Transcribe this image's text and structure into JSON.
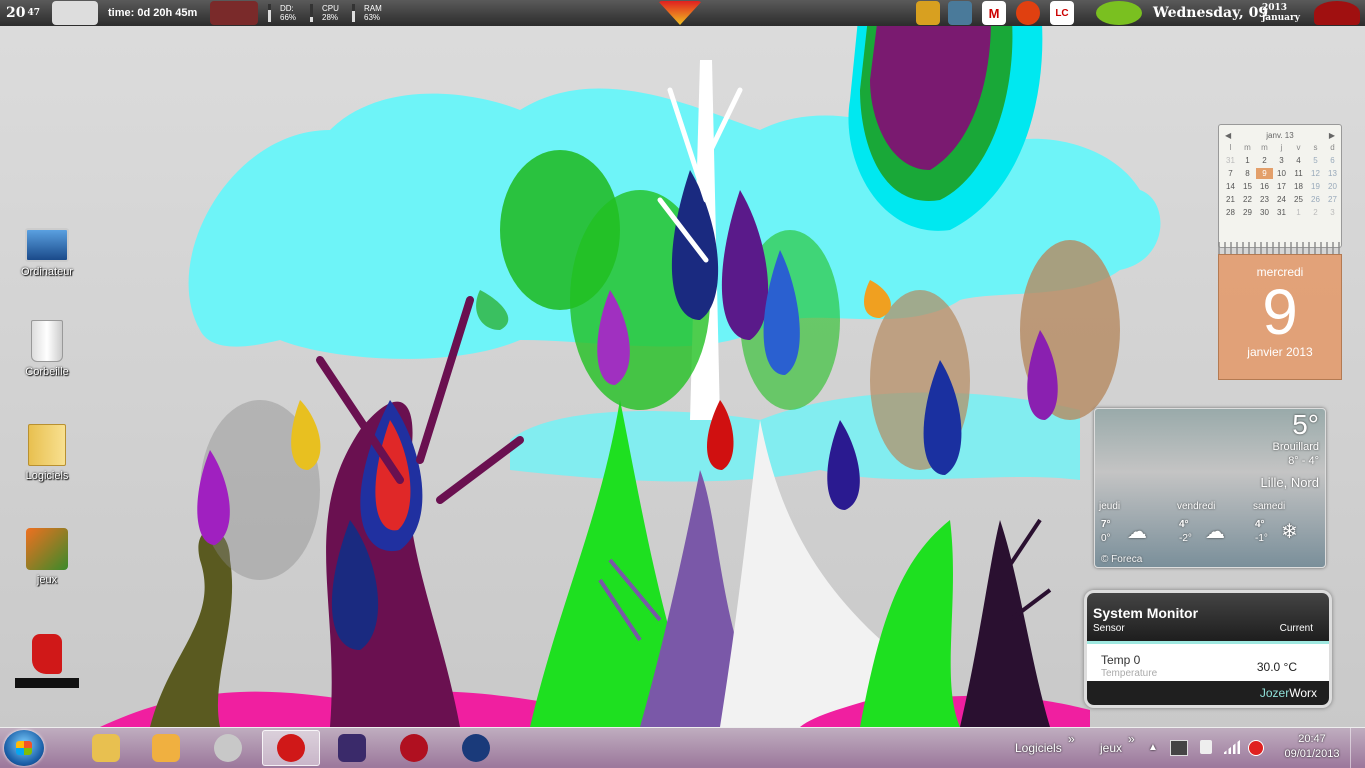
{
  "topbar": {
    "time_hour_min": "20",
    "time_sec": "47",
    "uptime": "time: 0d 20h 45m",
    "meters": [
      {
        "label": "DD:",
        "value": "66%",
        "fraction": 0.66
      },
      {
        "label": "CPU",
        "value": "28%",
        "fraction": 0.28
      },
      {
        "label": "RAM",
        "value": "63%",
        "fraction": 0.63
      }
    ],
    "icon_m_label": "M",
    "icon_lc_label": "LC",
    "date_main": "Wednesday, 09",
    "date_year": "2013",
    "date_month": "january"
  },
  "desktop_icons": [
    {
      "label": "Ordinateur",
      "icon": "computer-icon"
    },
    {
      "label": "Corbeille",
      "icon": "recycle-bin-icon"
    },
    {
      "label": "Logiciels",
      "icon": "folder-icon"
    },
    {
      "label": "jeux",
      "icon": "games-icon"
    },
    {
      "label": "",
      "icon": "boot-shortcut-icon"
    }
  ],
  "calendar": {
    "month_label": "janv. 13",
    "prev_arrow": "◀",
    "next_arrow": "▶",
    "dow": [
      "l",
      "m",
      "m",
      "j",
      "v",
      "s",
      "d"
    ],
    "days": [
      [
        "31",
        "1",
        "2",
        "3",
        "4",
        "5",
        "6"
      ],
      [
        "7",
        "8",
        "9",
        "10",
        "11",
        "12",
        "13"
      ],
      [
        "14",
        "15",
        "16",
        "17",
        "18",
        "19",
        "20"
      ],
      [
        "21",
        "22",
        "23",
        "24",
        "25",
        "26",
        "27"
      ],
      [
        "28",
        "29",
        "30",
        "31",
        "1",
        "2",
        "3"
      ]
    ],
    "weekday": "mercredi",
    "day_number": "9",
    "month_year": "janvier 2013"
  },
  "weather": {
    "temperature": "5°",
    "condition": "Brouillard",
    "range": "8° - 4°",
    "location": "Lille, Nord",
    "forecast": [
      {
        "day": "jeudi",
        "high": "7°",
        "low": "0°",
        "icon": "☁"
      },
      {
        "day": "vendredi",
        "high": "4°",
        "low": "-2°",
        "icon": "☁"
      },
      {
        "day": "samedi",
        "high": "4°",
        "low": "-1°",
        "icon": "❄"
      }
    ],
    "credit": "© Foreca"
  },
  "sysmon": {
    "title": "System Monitor",
    "col_sensor": "Sensor",
    "col_current": "Current",
    "sensor_name": "Temp 0",
    "sensor_type": "Temperature",
    "sensor_value": "30.0  °C",
    "brand_a": "Jozer",
    "brand_b": "Worx"
  },
  "taskbar": {
    "pinned": [
      {
        "name": "explorer",
        "color": "#e8c050"
      },
      {
        "name": "mail",
        "color": "#f0b040"
      },
      {
        "name": "chrome",
        "color": "#c8c8c8"
      },
      {
        "name": "opera",
        "color": "#d01818"
      },
      {
        "name": "game-heroine",
        "color": "#3a2a6a"
      },
      {
        "name": "potion",
        "color": "#b01020"
      },
      {
        "name": "crown-app",
        "color": "#1a3a7a"
      }
    ],
    "toolbar_logiciels": "Logiciels",
    "toolbar_jeux": "jeux",
    "chevron": "»",
    "tray_expand": "▲",
    "time": "20:47",
    "date": "09/01/2013"
  },
  "colors": {
    "cyan_cloud": "#6ef4f8",
    "calendar_orange": "#e4966a",
    "monitor_accent": "#8fe0d8"
  }
}
